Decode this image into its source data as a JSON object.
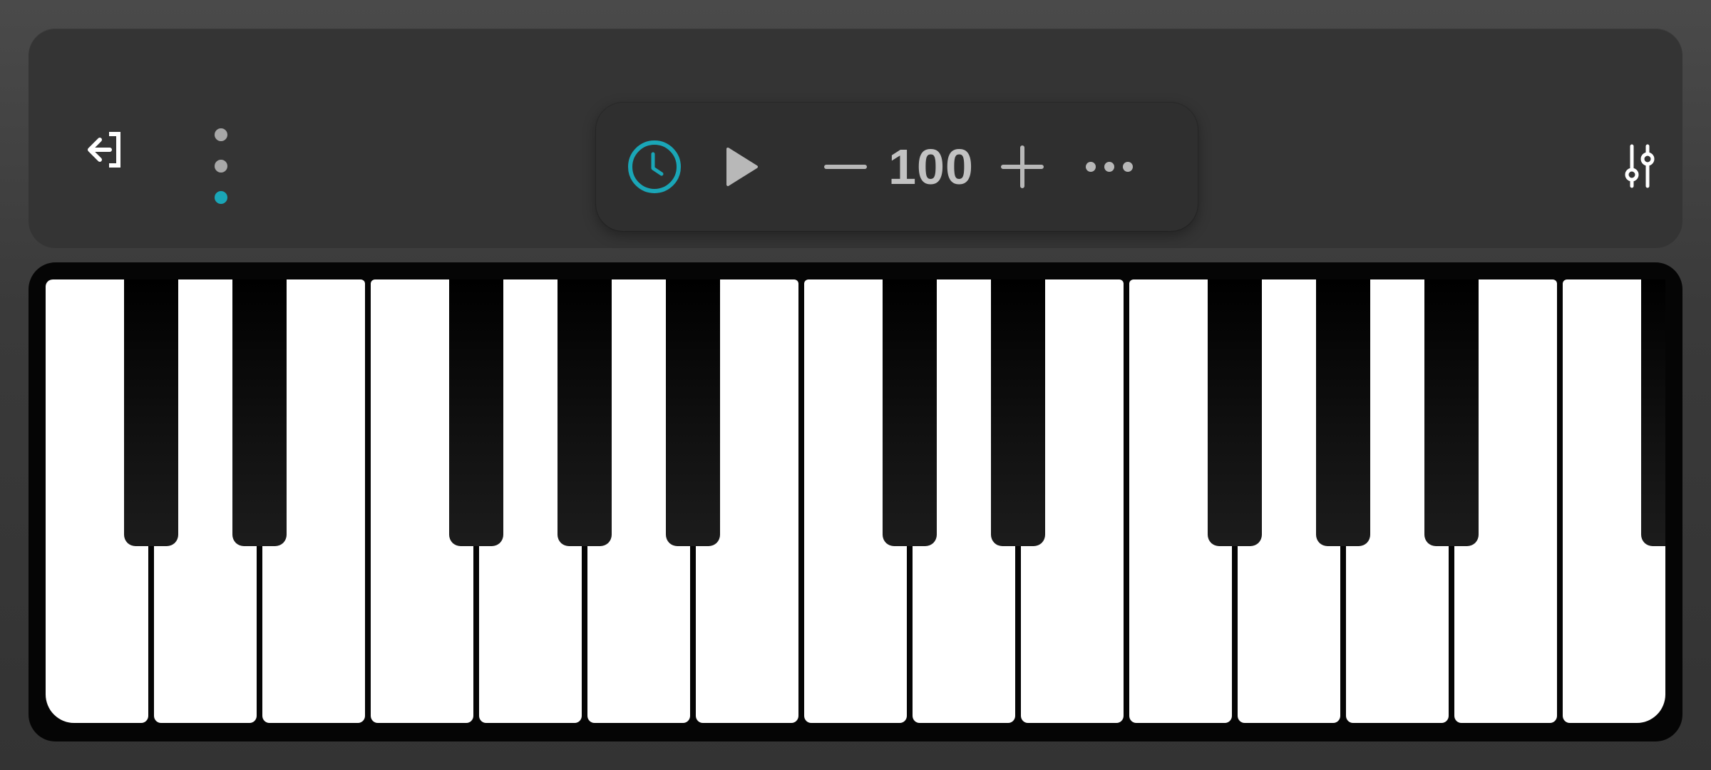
{
  "toolbar": {
    "exit_icon": "exit-icon",
    "page_indicator": {
      "pages": 3,
      "active_index": 2,
      "active_color": "#1aa6b7",
      "inactive_color": "#a8a8a8"
    },
    "mixer_icon": "sliders-icon"
  },
  "transport": {
    "metronome_icon": "clock-icon",
    "metronome_color": "#1aa6b7",
    "play_icon": "play-icon",
    "decrease_icon": "minus-icon",
    "tempo_value": "100",
    "increase_icon": "plus-icon",
    "more_icon": "more-horizontal-icon"
  },
  "keyboard": {
    "white_key_count": 15,
    "black_key_count": 11,
    "black_keys_after_white": [
      0,
      1,
      3,
      4,
      5,
      7,
      8,
      10,
      11,
      12,
      14
    ],
    "white_key_color": "#ffffff",
    "black_key_color": "#111111"
  }
}
